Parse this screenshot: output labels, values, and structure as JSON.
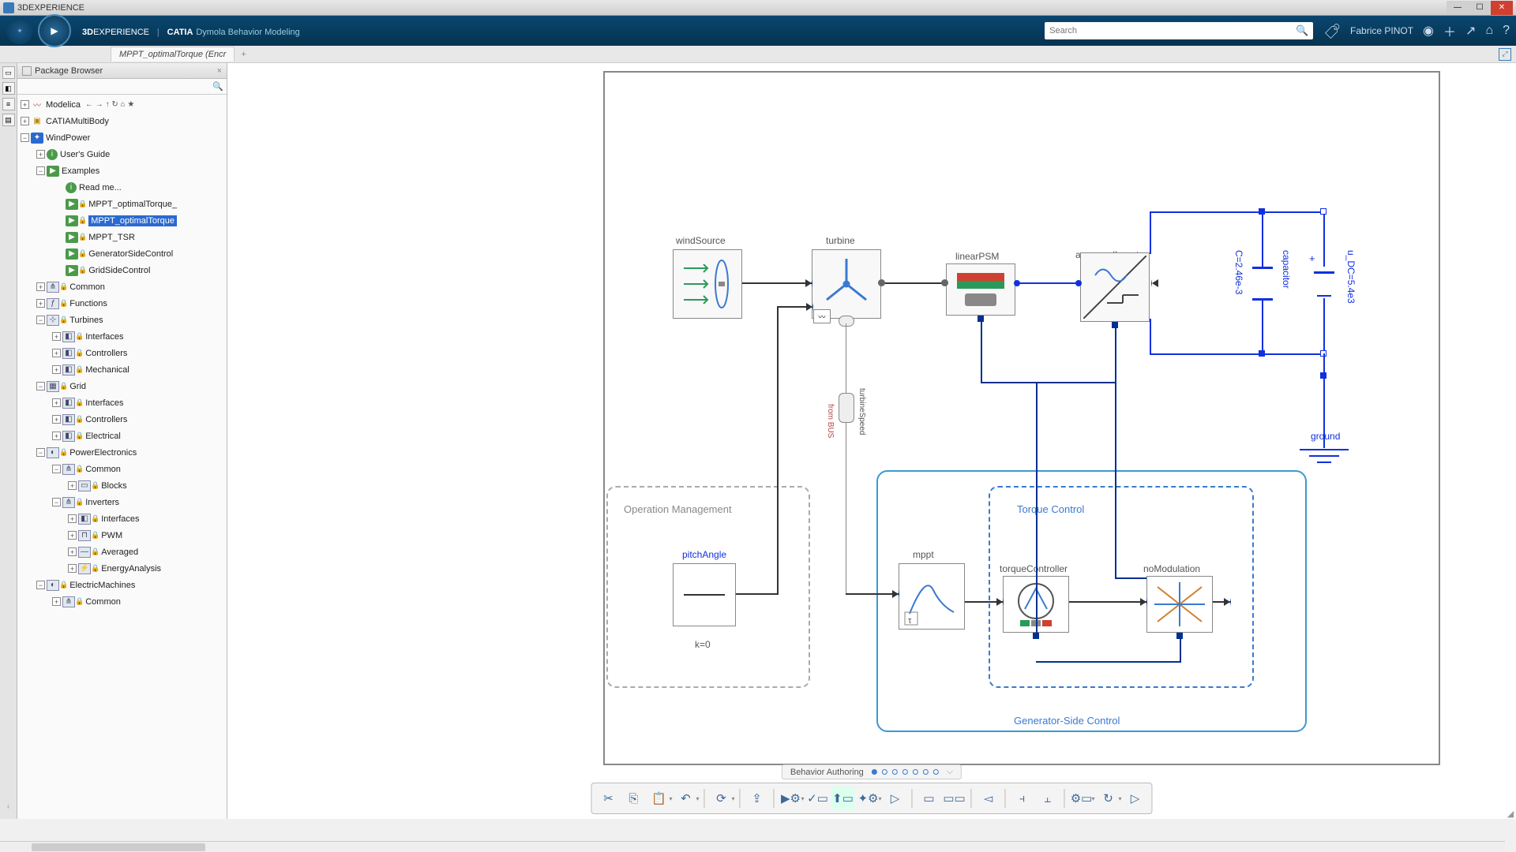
{
  "titlebar": {
    "text": "3DEXPERIENCE"
  },
  "header": {
    "brand_prefix": "3D",
    "brand_main": "EXPERIENCE",
    "brand_sep": "|",
    "brand_app": "CATIA",
    "brand_mode": "Dymola Behavior Modeling",
    "search_placeholder": "Search",
    "user": "Fabrice PINOT"
  },
  "tab": {
    "name": "MPPT_optimalTorque (Encr"
  },
  "browser": {
    "title": "Package Browser"
  },
  "tree": {
    "modelica": "Modelica",
    "catia": "CATIAMultiBody",
    "windpower": "WindPower",
    "guide": "User's Guide",
    "examples": "Examples",
    "readme": "Read me...",
    "mppt_opt1": "MPPT_optimalTorque_",
    "mppt_opt2": "MPPT_optimalTorque",
    "mppt_tsr": "MPPT_TSR",
    "gensidectrl": "GeneratorSideControl",
    "gridsidectrl": "GridSideControl",
    "common": "Common",
    "functions": "Functions",
    "turbines": "Turbines",
    "interfaces": "Interfaces",
    "controllers": "Controllers",
    "mechanical": "Mechanical",
    "grid": "Grid",
    "electrical": "Electrical",
    "powerelec": "PowerElectronics",
    "blocks": "Blocks",
    "inverters": "Inverters",
    "pwm": "PWM",
    "averaged": "Averaged",
    "energy": "EnergyAnalysis",
    "elecmach": "ElectricMachines",
    "common2": "Common"
  },
  "diagram": {
    "windSource": "windSource",
    "turbine": "turbine",
    "linearPSM": "linearPSM",
    "averagedInverter": "averagedInverter",
    "capacitor": "capacitor",
    "cval": "C=2.46e-3",
    "udc": "u_DC=5.4e3",
    "ground": "ground",
    "opmgmt": "Operation Management",
    "pitchAngle": "pitchAngle",
    "k0": "k=0",
    "torqueCtrl": "Torque Control",
    "mppt": "mppt",
    "torqueController": "torqueController",
    "noModulation": "noModulation",
    "genside": "Generator-Side Control",
    "turbineSpeed": "turbineSpeed",
    "fromBus": "from BUS"
  },
  "bottom": {
    "label": "Behavior Authoring"
  }
}
